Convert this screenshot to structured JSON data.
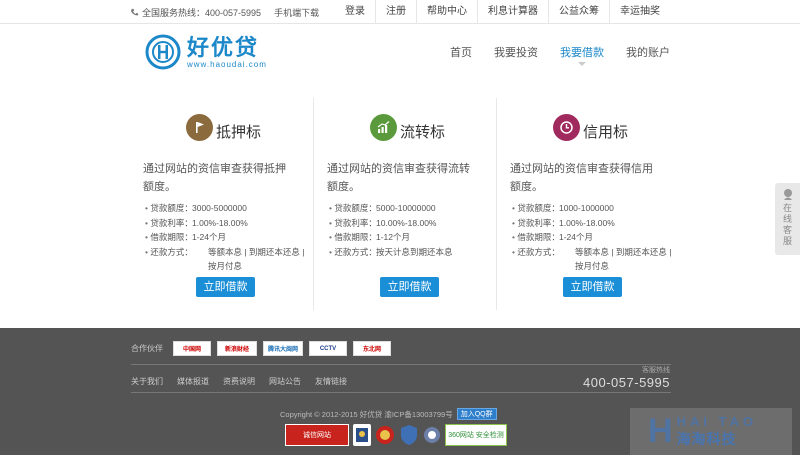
{
  "topbar": {
    "hotline_label": "全国服务热线：400-057-5995",
    "app_download": "手机端下载",
    "links": [
      "登录",
      "注册",
      "帮助中心",
      "利息计算器",
      "公益众筹",
      "幸运抽奖"
    ]
  },
  "header": {
    "logo_cn": "好优贷",
    "logo_url": "www.haoudai.com",
    "nav": [
      "首页",
      "我要投资",
      "我要借款",
      "我的账户"
    ],
    "nav_active": "我要借款"
  },
  "cards": [
    {
      "title": "抵押标",
      "icon": "flag-icon",
      "icon_color": "#8b6a3e",
      "desc": "通过网站的资信审查获得抵押额度。",
      "specs": [
        {
          "k": "贷款额度：",
          "v": "3000-5000000"
        },
        {
          "k": "贷款利率：",
          "v": "1.00%-18.00%"
        },
        {
          "k": "借款期限：",
          "v": "1-24个月"
        },
        {
          "k": "还款方式：",
          "v": "等额本息 | 到期还本还息 | 按月付息"
        }
      ],
      "button": "立即借款"
    },
    {
      "title": "流转标",
      "icon": "bar-chart-icon",
      "icon_color": "#5a9a3c",
      "desc": "通过网站的资信审查获得流转额度。",
      "specs": [
        {
          "k": "贷款额度：",
          "v": "5000-10000000"
        },
        {
          "k": "贷款利率：",
          "v": "10.00%-18.00%"
        },
        {
          "k": "借款期限：",
          "v": "1-12个月"
        },
        {
          "k": "还款方式：",
          "v": "按天计息到期还本息"
        }
      ],
      "button": "立即借款"
    },
    {
      "title": "信用标",
      "icon": "clock-icon",
      "icon_color": "#a02a5e",
      "desc": "通过网站的资信审查获得信用额度。",
      "specs": [
        {
          "k": "贷款额度：",
          "v": "1000-1000000"
        },
        {
          "k": "贷款利率：",
          "v": "1.00%-18.00%"
        },
        {
          "k": "借款期限：",
          "v": "1-24个月"
        },
        {
          "k": "还款方式：",
          "v": "等额本息 | 到期还本还息 | 按月付息"
        }
      ],
      "button": "立即借款"
    }
  ],
  "footer": {
    "partners_label": "合作伙伴",
    "partners": [
      "中国网",
      "新浪财经",
      "腾讯大闽网",
      "CCTV",
      "东北网"
    ],
    "links": [
      "关于我们",
      "媒体报道",
      "资费说明",
      "网站公告",
      "友情链接"
    ],
    "hotline_label": "客服热线",
    "hotline": "400-057-5995",
    "copyright": "Copyright © 2012-2015  好优贷  渝ICP备13003799号",
    "qq_group": "加入QQ群",
    "badges": [
      "诚信网站",
      "360网站 安全检测"
    ]
  },
  "service_widget": "在线客服",
  "watermark": {
    "en": "HAI TAO",
    "cn": "海淘科技"
  }
}
